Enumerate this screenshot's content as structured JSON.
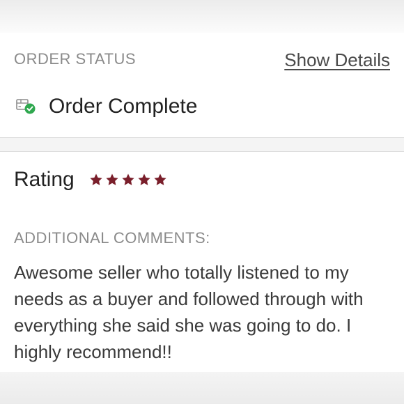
{
  "order": {
    "section_label": "ORDER STATUS",
    "show_details_label": "Show Details",
    "status_text": "Order Complete",
    "status_icon": "package-check-icon",
    "status_color": "#2fa84f"
  },
  "review": {
    "rating_label": "Rating",
    "rating": 5,
    "rating_max": 5,
    "star_color": "#7a1f2b",
    "comments_label": "ADDITIONAL COMMENTS:",
    "comment_text": "Awesome seller who totally listened to my needs as a buyer and followed through with everything she said she was going to do. I highly recommend!!"
  }
}
